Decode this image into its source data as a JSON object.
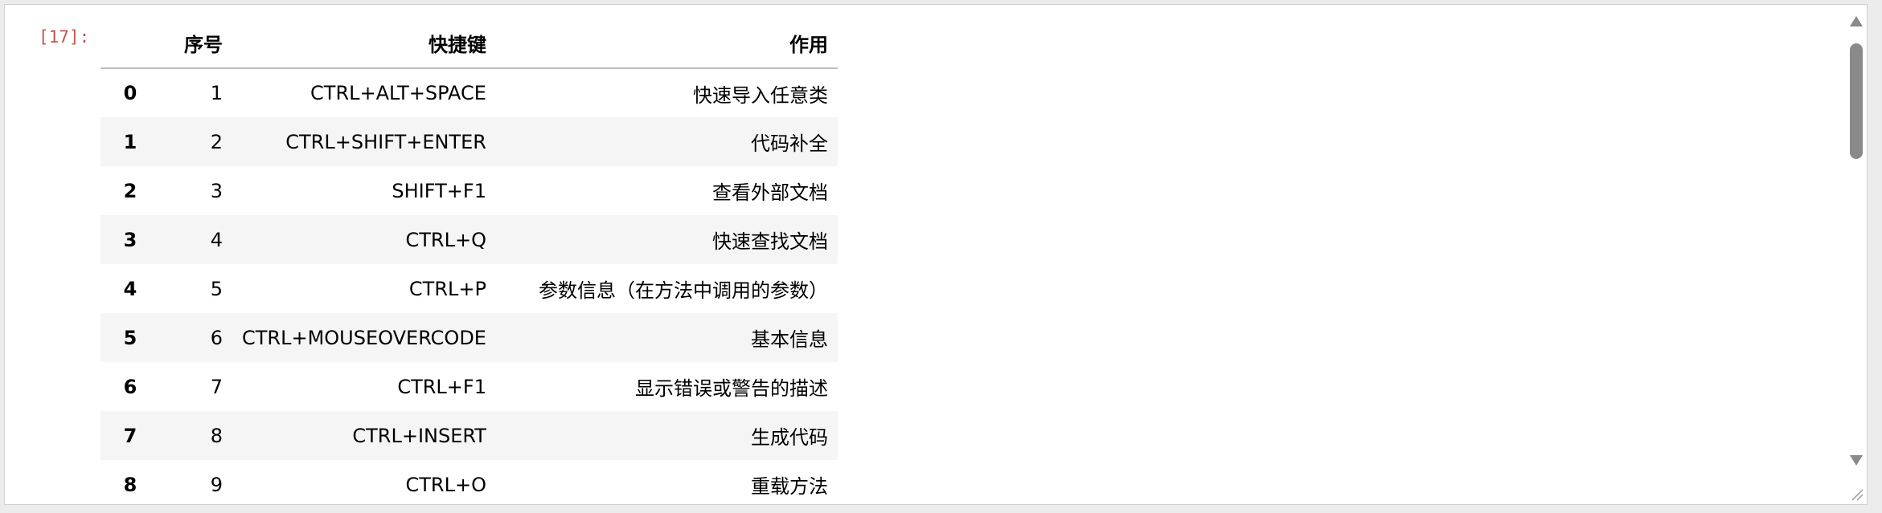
{
  "cell": {
    "prompt": "[17]:"
  },
  "table": {
    "columns": [
      "序号",
      "快捷键",
      "作用"
    ],
    "rows": [
      {
        "index": "0",
        "seq": "1",
        "key": "CTRL+ALT+SPACE",
        "use": "快速导入任意类"
      },
      {
        "index": "1",
        "seq": "2",
        "key": "CTRL+SHIFT+ENTER",
        "use": "代码补全"
      },
      {
        "index": "2",
        "seq": "3",
        "key": "SHIFT+F1",
        "use": "查看外部文档"
      },
      {
        "index": "3",
        "seq": "4",
        "key": "CTRL+Q",
        "use": "快速查找文档"
      },
      {
        "index": "4",
        "seq": "5",
        "key": "CTRL+P",
        "use": "参数信息（在方法中调用的参数）"
      },
      {
        "index": "5",
        "seq": "6",
        "key": "CTRL+MOUSEOVERCODE",
        "use": "基本信息"
      },
      {
        "index": "6",
        "seq": "7",
        "key": "CTRL+F1",
        "use": "显示错误或警告的描述"
      },
      {
        "index": "7",
        "seq": "8",
        "key": "CTRL+INSERT",
        "use": "生成代码"
      },
      {
        "index": "8",
        "seq": "9",
        "key": "CTRL+O",
        "use": "重载方法"
      }
    ]
  },
  "icons": {
    "scroll_up": "arrow-up-icon",
    "scroll_down": "arrow-down-icon",
    "resize": "resize-grip-icon"
  },
  "colors": {
    "prompt": "#c1544e",
    "stripe": "#f5f5f5",
    "scrollbar": "#8a8a8a"
  }
}
